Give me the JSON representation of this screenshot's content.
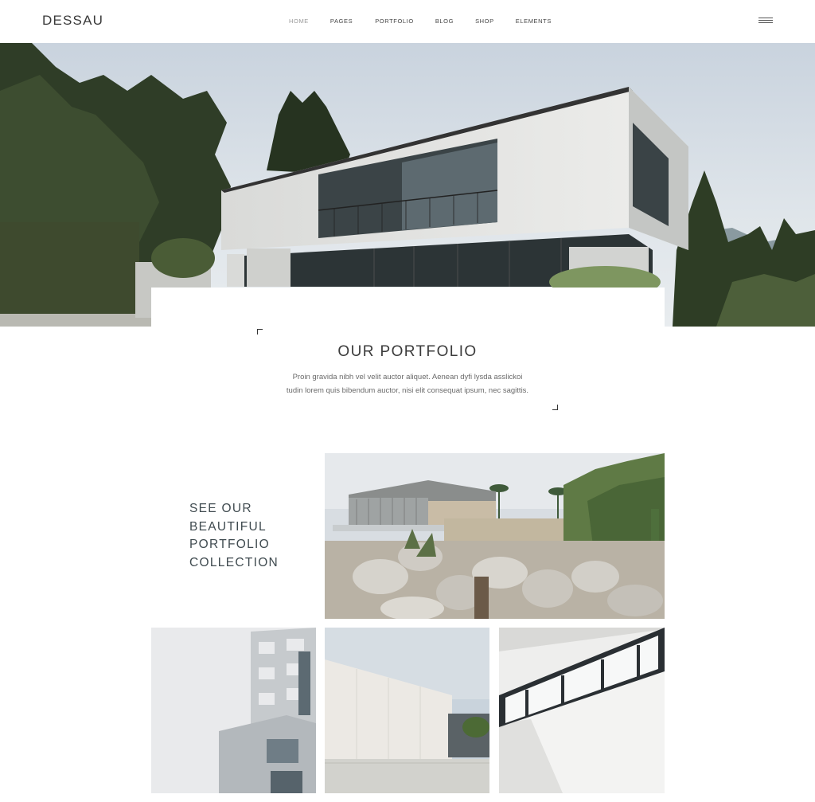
{
  "header": {
    "logo": "DESSAU",
    "nav": [
      {
        "label": "HOME",
        "active": true
      },
      {
        "label": "PAGES",
        "active": false
      },
      {
        "label": "PORTFOLIO",
        "active": false
      },
      {
        "label": "BLOG",
        "active": false
      },
      {
        "label": "SHOP",
        "active": false
      },
      {
        "label": "ELEMENTS",
        "active": false
      }
    ],
    "menu_icon": "hamburger-menu-icon"
  },
  "portfolio": {
    "title": "OUR PORTFOLIO",
    "description_line1": "Proin gravida nibh vel velit auctor aliquet. Aenean dyfi lysda asslickoi",
    "description_line2": "tudin lorem quis bibendum auctor, nisi elit consequat ipsum, nec sagittis."
  },
  "collection": {
    "lines": [
      "SEE OUR",
      "BEAUTIFUL",
      "PORTFOLIO",
      "COLLECTION"
    ]
  },
  "colors": {
    "accent_text": "#3f4a4f",
    "active_nav": "#9a9a9a"
  }
}
